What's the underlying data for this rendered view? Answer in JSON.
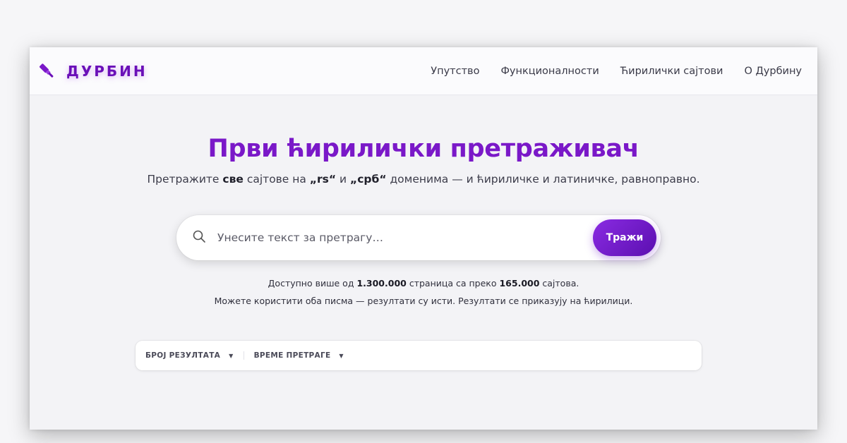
{
  "brand": {
    "name": "ДУРБИН",
    "icon": "telescope-icon",
    "color": "#6a0fb8"
  },
  "nav": {
    "items": [
      {
        "label": "Упутство"
      },
      {
        "label": "Функционалности"
      },
      {
        "label": "Ћирилички сајтови"
      },
      {
        "label": "О Дурбину"
      }
    ]
  },
  "hero": {
    "title": "Први ћирилички претраживач",
    "sub_part1": "Претражите ",
    "sub_bold1": "све",
    "sub_part2": " сајтове на ",
    "sub_bold2": "„rs“",
    "sub_part3": " и ",
    "sub_bold3": "„срб“",
    "sub_part4": " доменима — и ћириличке и латиничке, равноправно."
  },
  "search": {
    "placeholder": "Унесите текст за претрагу…",
    "value": "",
    "button_label": "Тражи",
    "icon": "search-icon",
    "accent": "#7a18c8"
  },
  "stats": {
    "line1_part1": "Доступно више од ",
    "pages_count": "1.300.000",
    "line1_part2": " страница са преко ",
    "sites_count": "165.000",
    "line1_part3": " сајтова.",
    "line2": "Можете користити оба писма — резултати су исти. Резултати се приказују на ћирилици."
  },
  "filters": {
    "items": [
      {
        "label": "БРОЈ РЕЗУЛТАТА",
        "icon": "caret-down-icon"
      },
      {
        "label": "ВРЕМЕ ПРЕТРАГЕ",
        "icon": "caret-down-icon"
      }
    ]
  }
}
